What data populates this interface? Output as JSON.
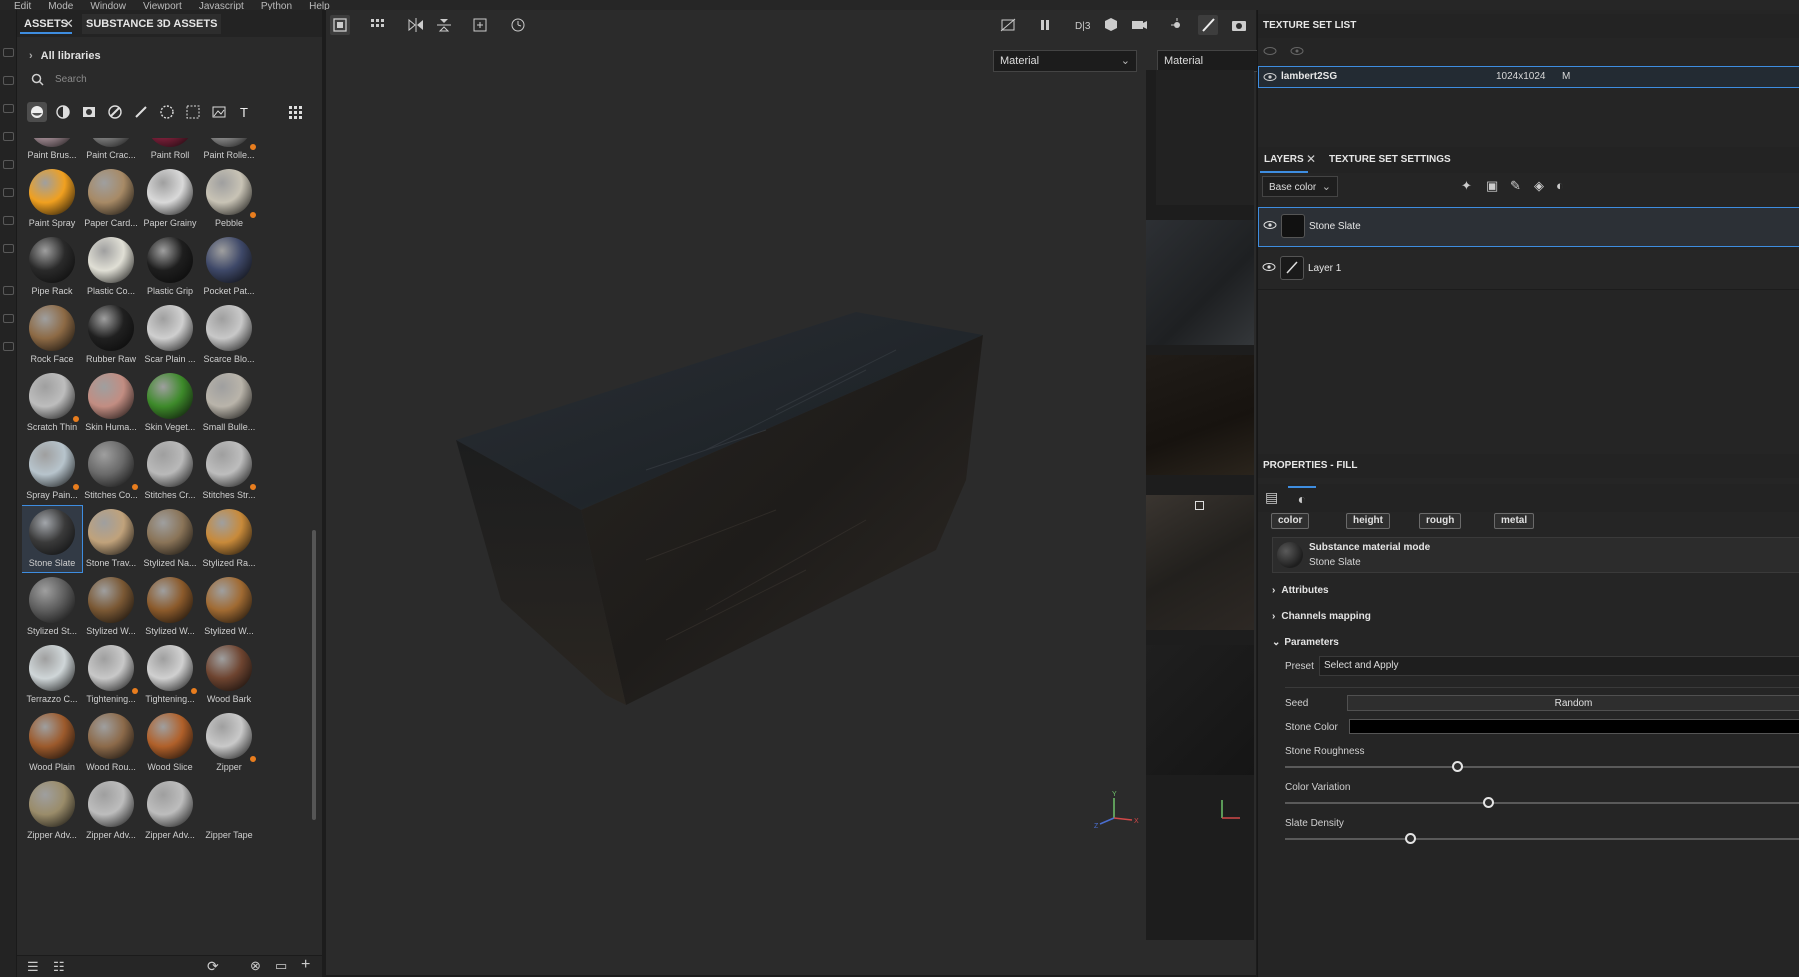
{
  "menu": [
    "Edit",
    "Mode",
    "Window",
    "Viewport",
    "Javascript",
    "Python",
    "Help"
  ],
  "assets": {
    "tab_assets": "ASSETS",
    "tab_substance": "SUBSTANCE 3D ASSETS",
    "all_libraries": "All libraries",
    "search_placeholder": "Search",
    "filter_icons": [
      "sphere-icon",
      "smart-material-icon",
      "texture-icon",
      "procedural-icon",
      "brush-icon",
      "pattern-icon",
      "grid-pattern-icon",
      "image-icon",
      "text-icon",
      "apps-grid-icon"
    ],
    "items": [
      {
        "name": "Paint Brus...",
        "color": "#b39aa3",
        "dot": false
      },
      {
        "name": "Paint Crac...",
        "color": "#8d8d8d",
        "dot": false
      },
      {
        "name": "Paint Roll",
        "color": "#8b2340",
        "dot": false
      },
      {
        "name": "Paint Rolle...",
        "color": "#9a9a9a",
        "dot": true
      },
      {
        "name": "Paint Spray",
        "color": "#f0a020",
        "dot": false
      },
      {
        "name": "Paper Card...",
        "color": "#a78a66",
        "dot": false
      },
      {
        "name": "Paper Grainy",
        "color": "#d9d9d9",
        "dot": false
      },
      {
        "name": "Pebble",
        "color": "#c8c3b5",
        "dot": true
      },
      {
        "name": "Pipe Rack",
        "color": "#2a2a2a",
        "dot": false
      },
      {
        "name": "Plastic Co...",
        "color": "#e0dfd5",
        "dot": false
      },
      {
        "name": "Plastic Grip",
        "color": "#1e1e1e",
        "dot": false
      },
      {
        "name": "Pocket Pat...",
        "color": "#3e4868",
        "dot": false
      },
      {
        "name": "Rock Face",
        "color": "#8d6a45",
        "dot": false
      },
      {
        "name": "Rubber Raw",
        "color": "#202020",
        "dot": false
      },
      {
        "name": "Scar Plain ...",
        "color": "#cfcfcf",
        "dot": false
      },
      {
        "name": "Scarce Blo...",
        "color": "#c8c8c8",
        "dot": false
      },
      {
        "name": "Scratch Thin",
        "color": "#bdbdbd",
        "dot": true
      },
      {
        "name": "Skin Huma...",
        "color": "#c28d82",
        "dot": false
      },
      {
        "name": "Skin Veget...",
        "color": "#3d8a2a",
        "dot": false
      },
      {
        "name": "Small Bulle...",
        "color": "#b9b4aa",
        "dot": false
      },
      {
        "name": "Spray Pain...",
        "color": "#b7c4cc",
        "dot": true
      },
      {
        "name": "Stitches Co...",
        "color": "#6a6a6a",
        "dot": true
      },
      {
        "name": "Stitches Cr...",
        "color": "#b9b9b9",
        "dot": false
      },
      {
        "name": "Stitches Str...",
        "color": "#bdbdbd",
        "dot": true
      },
      {
        "name": "Stone Slate",
        "color": "#3a3a3a",
        "dot": false,
        "selected": true
      },
      {
        "name": "Stone Trav...",
        "color": "#c0a27b",
        "dot": false
      },
      {
        "name": "Stylized Na...",
        "color": "#8a7458",
        "dot": false
      },
      {
        "name": "Stylized Ra...",
        "color": "#c88a3a",
        "dot": false
      },
      {
        "name": "Stylized St...",
        "color": "#5e5e5e",
        "dot": false
      },
      {
        "name": "Stylized W...",
        "color": "#7a5834",
        "dot": false
      },
      {
        "name": "Stylized W...",
        "color": "#8b5a2b",
        "dot": false
      },
      {
        "name": "Stylized W...",
        "color": "#a06a32",
        "dot": false
      },
      {
        "name": "Terrazzo C...",
        "color": "#cfd6d8",
        "dot": false
      },
      {
        "name": "Tightening...",
        "color": "#c8c8c8",
        "dot": true
      },
      {
        "name": "Tightening...",
        "color": "#d0d0d0",
        "dot": true
      },
      {
        "name": "Wood Bark",
        "color": "#6e4430",
        "dot": false
      },
      {
        "name": "Wood Plain",
        "color": "#9c5a2c",
        "dot": false
      },
      {
        "name": "Wood Rou...",
        "color": "#8c6a4a",
        "dot": false
      },
      {
        "name": "Wood Slice",
        "color": "#b0602a",
        "dot": false
      },
      {
        "name": "Zipper",
        "color": "#c9c9c9",
        "dot": true
      },
      {
        "name": "Zipper Adv...",
        "color": "#9a8c6a",
        "dot": false
      },
      {
        "name": "Zipper Adv...",
        "color": "#bdbdbd",
        "dot": false
      },
      {
        "name": "Zipper Adv...",
        "color": "#bdbdbd",
        "dot": false
      },
      {
        "name": "Zipper Tape",
        "color": "transparent",
        "dot": false
      }
    ]
  },
  "viewport": {
    "material_dropdown": "Material",
    "material_dropdown_uv": "Material"
  },
  "texture_set_list": {
    "title": "TEXTURE SET LIST",
    "set_name": "lambert2SG",
    "resolution": "1024x1024",
    "extra": "M"
  },
  "layers": {
    "tab_layers": "LAYERS",
    "tab_settings": "TEXTURE SET SETTINGS",
    "channel_dropdown": "Base color",
    "items": [
      {
        "name": "Stone Slate"
      },
      {
        "name": "Layer 1"
      }
    ]
  },
  "properties": {
    "title": "PROPERTIES - FILL",
    "channels": [
      "color",
      "height",
      "rough",
      "metal"
    ],
    "material_mode": "Substance material mode",
    "material_name": "Stone Slate",
    "attributes": "Attributes",
    "channels_mapping": "Channels mapping",
    "parameters": "Parameters",
    "preset_label": "Preset",
    "preset_value": "Select and Apply",
    "seed_label": "Seed",
    "seed_value": "Random",
    "stone_color_label": "Stone Color",
    "stone_roughness_label": "Stone Roughness",
    "stone_roughness_value": 0.55,
    "color_variation_label": "Color Variation",
    "color_variation_value": 0.65,
    "slate_density_label": "Slate Density",
    "slate_density_value": 0.4
  }
}
